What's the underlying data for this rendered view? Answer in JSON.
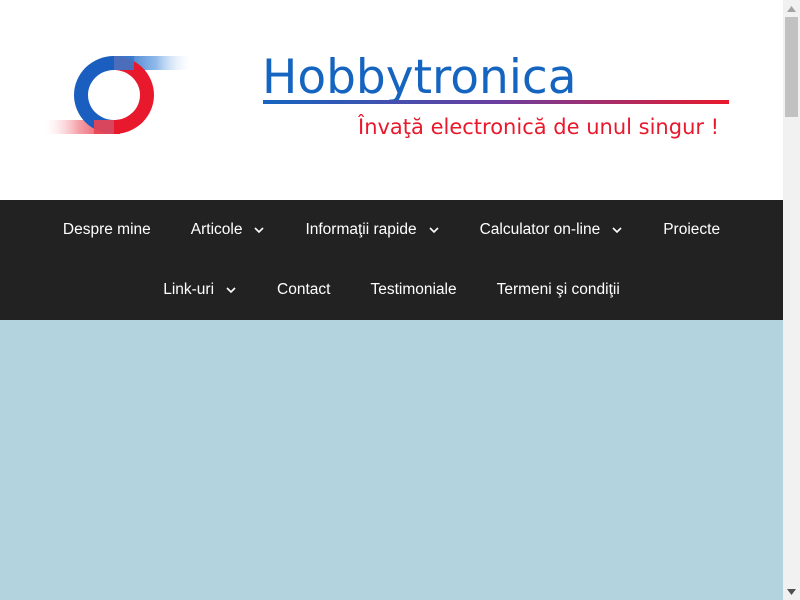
{
  "brand": {
    "title": "Hobbytronica",
    "tagline": "Învaţă electronică de unul singur !",
    "logo_icon": "hobbytronica-logo-icon",
    "colors": {
      "blue": "#1565c0",
      "red": "#e8192c"
    }
  },
  "nav": {
    "row1": [
      {
        "label": "Despre mine",
        "dropdown": false
      },
      {
        "label": "Articole",
        "dropdown": true
      },
      {
        "label": "Informaţii rapide",
        "dropdown": true
      },
      {
        "label": "Calculator on-line",
        "dropdown": true
      },
      {
        "label": "Proiecte",
        "dropdown": false
      }
    ],
    "row2": [
      {
        "label": "Link-uri",
        "dropdown": true
      },
      {
        "label": "Contact",
        "dropdown": false
      },
      {
        "label": "Testimoniale",
        "dropdown": false
      },
      {
        "label": "Termeni şi condiţii",
        "dropdown": false
      }
    ],
    "background": "#222222",
    "text_color": "#ffffff"
  },
  "content": {
    "background": "#b3d4de"
  }
}
